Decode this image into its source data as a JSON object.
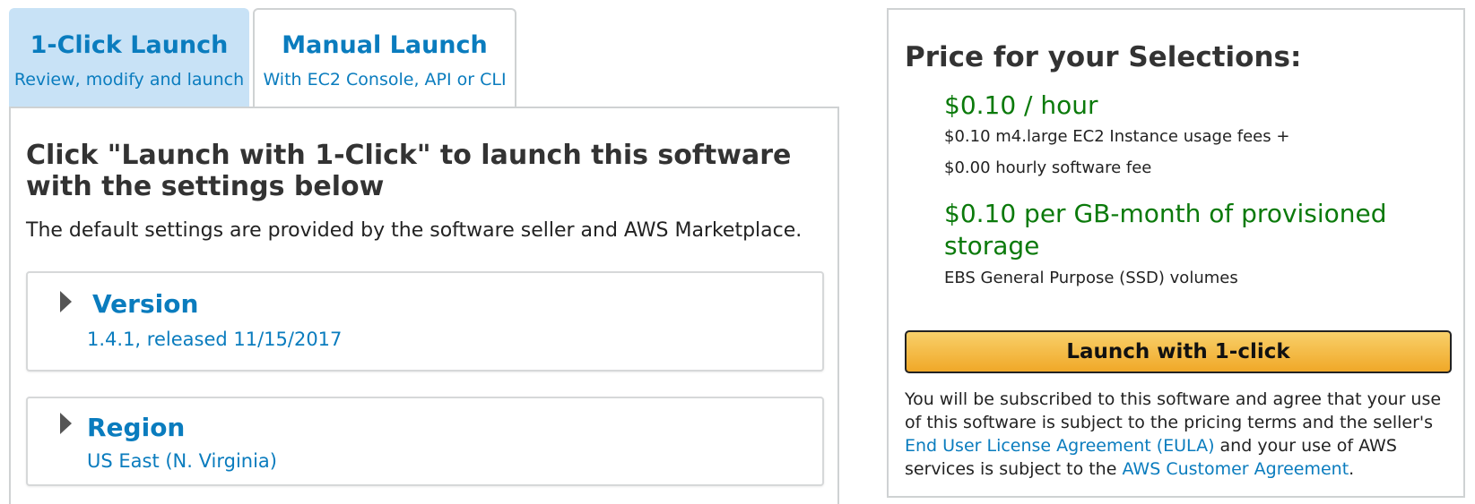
{
  "tabs": [
    {
      "title": "1-Click Launch",
      "subtitle": "Review, modify and launch",
      "active": true
    },
    {
      "title": "Manual Launch",
      "subtitle": "With EC2 Console, API or CLI",
      "active": false
    }
  ],
  "main": {
    "heading": "Click \"Launch with 1-Click\" to launch this software with the settings below",
    "description": "The default settings are provided by the software seller and AWS Marketplace.",
    "version": {
      "label": "Version",
      "value": "1.4.1, released 11/15/2017"
    },
    "region": {
      "label": "Region",
      "value": "US East (N. Virginia)"
    }
  },
  "pricing": {
    "heading": "Price for your Selections:",
    "hourly_price": "$0.10 / hour",
    "instance_fee": "$0.10 m4.large EC2 Instance usage fees +",
    "software_fee": "$0.00 hourly software fee",
    "storage_price": "$0.10 per GB-month of provisioned storage",
    "storage_type": "EBS General Purpose (SSD) volumes",
    "launch_button": "Launch with 1-click",
    "terms_before_eula": "You will be subscribed to this software and agree that your use of this software is subject to the pricing terms and the seller's",
    "eula_link": "End User License Agreement (EULA)",
    "terms_middle": "and your use of AWS services is subject to the",
    "customer_agreement_link": "AWS Customer Agreement",
    "terms_end": "."
  },
  "colors": {
    "link": "#0a7cbe",
    "price_green": "#0b7a0b",
    "active_tab": "#c8e2f6",
    "button_gradient_top": "#f8d06a",
    "button_gradient_bottom": "#f0a828"
  },
  "icons": {
    "expand": "caret-right-icon"
  }
}
